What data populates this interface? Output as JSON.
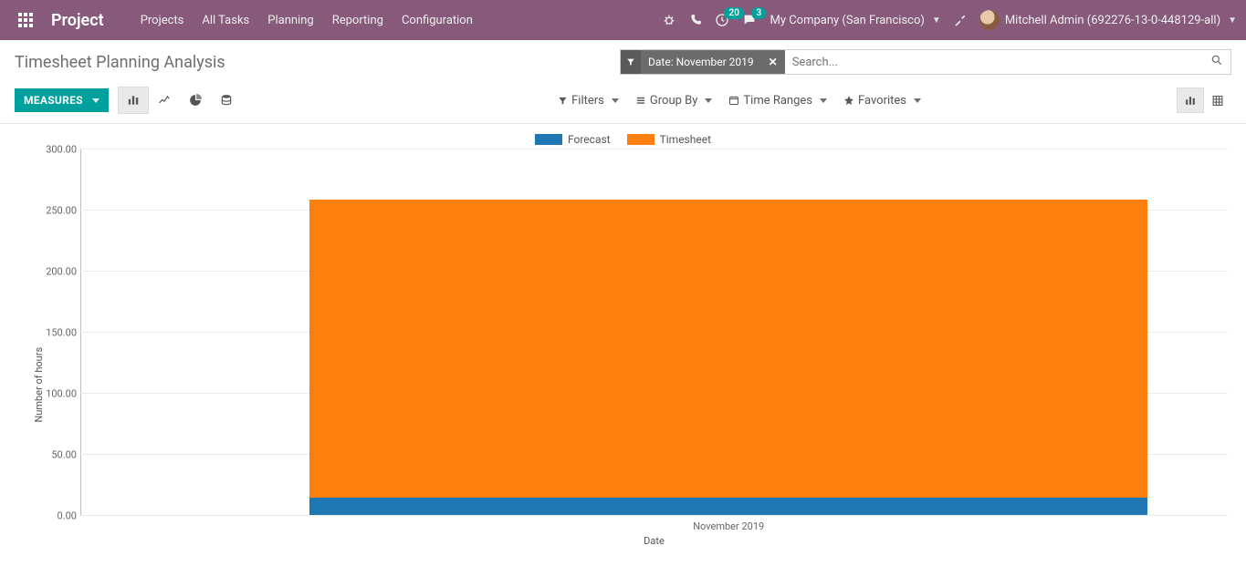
{
  "topnav": {
    "brand": "Project",
    "menu": [
      "Projects",
      "All Tasks",
      "Planning",
      "Reporting",
      "Configuration"
    ],
    "activities_badge": "20",
    "discuss_badge": "3",
    "company": "My Company (San Francisco)",
    "user": "Mitchell Admin (692276-13-0-448129-all)"
  },
  "breadcrumb": {
    "title": "Timesheet Planning Analysis"
  },
  "search": {
    "facet_label": "Date: November 2019",
    "placeholder": "Search..."
  },
  "toolbar": {
    "measures_label": "MEASURES",
    "filters_label": "Filters",
    "groupby_label": "Group By",
    "timeranges_label": "Time Ranges",
    "favorites_label": "Favorites"
  },
  "legend": {
    "forecast": "Forecast",
    "timesheet": "Timesheet"
  },
  "axes": {
    "y_label": "Number of hours",
    "x_label": "Date",
    "y_ticks": [
      "0.00",
      "50.00",
      "100.00",
      "150.00",
      "200.00",
      "250.00",
      "300.00"
    ],
    "x_tick": "November 2019"
  },
  "colors": {
    "forecast": "#1f77b4",
    "timesheet": "#ff7f0e",
    "accent": "#00a09d",
    "brand_bg": "#875a7b"
  },
  "chart_data": {
    "type": "bar",
    "stacked": true,
    "categories": [
      "November 2019"
    ],
    "series": [
      {
        "name": "Forecast",
        "values": [
          14
        ]
      },
      {
        "name": "Timesheet",
        "values": [
          244
        ]
      }
    ],
    "title": "",
    "xlabel": "Date",
    "ylabel": "Number of hours",
    "ylim": [
      0,
      300
    ]
  }
}
